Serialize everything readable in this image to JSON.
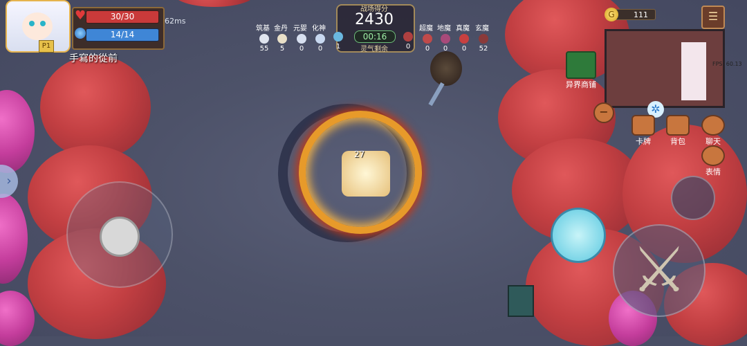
{
  "player": {
    "hp_text": "30/30",
    "mp_text": "14/14",
    "ping": "62ms",
    "name": "手寫的從前",
    "badge": "P1"
  },
  "battle": {
    "score_label": "战场得分",
    "score": "2430",
    "timer": "00:16",
    "qi_label": "灵气剩余"
  },
  "factions_left": [
    {
      "label": "筑基",
      "count": "55"
    },
    {
      "label": "金丹",
      "count": "5"
    },
    {
      "label": "元婴",
      "count": "0"
    },
    {
      "label": "化神",
      "count": "0"
    },
    {
      "label": "",
      "count": "1"
    }
  ],
  "factions_right": [
    {
      "label": "",
      "count": "0"
    },
    {
      "label": "超魔",
      "count": "0"
    },
    {
      "label": "地魔",
      "count": "0"
    },
    {
      "label": "真魔",
      "count": "0"
    },
    {
      "label": "玄魔",
      "count": "52"
    }
  ],
  "currency": {
    "coins": "111",
    "coin_symbol": "G"
  },
  "minimap": {
    "fps": "FPS: 60.13"
  },
  "shop": {
    "label": "异界商铺"
  },
  "side_buttons": {
    "cards": "卡牌",
    "bag": "背包",
    "chat": "聊天",
    "emote": "表情"
  },
  "effects": {
    "damage": "27"
  },
  "icons": {
    "menu": "menu-icon",
    "expand": "chevron-right-icon",
    "minus": "minus-icon",
    "swirl": "swirl-icon",
    "attack": "sword-icon"
  },
  "colors": {
    "hp": "#c93a3a",
    "mp": "#3f86d6",
    "timer": "#9ff0a6",
    "ring": "#e79a2a"
  }
}
